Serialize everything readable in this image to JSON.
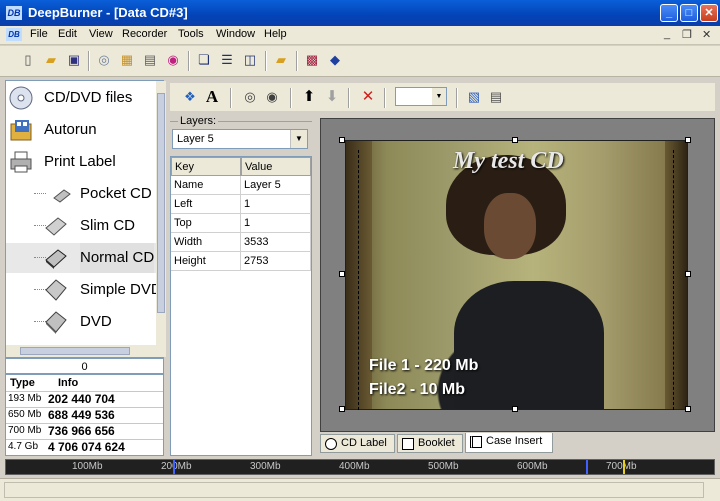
{
  "window": {
    "title": "DeepBurner - [Data CD#3]",
    "logo_text": "DB",
    "minimize_glyph": "_",
    "maximize_glyph": "□",
    "close_glyph": "✕"
  },
  "menu": {
    "items": [
      "File",
      "Edit",
      "View",
      "Recorder",
      "Tools",
      "Window",
      "Help"
    ],
    "mdi": {
      "minimize": "_",
      "restore": "❐",
      "close": "✕"
    }
  },
  "tree": {
    "items": [
      {
        "label": "CD/DVD files",
        "icon": "cd-disc-icon"
      },
      {
        "label": "Autorun",
        "icon": "autorun-icon"
      },
      {
        "label": "Print Label",
        "icon": "printer-icon"
      },
      {
        "label": "Pocket CD",
        "icon": "pocket-cd-icon"
      },
      {
        "label": "Slim CD",
        "icon": "slim-cd-icon"
      },
      {
        "label": "Normal CD",
        "icon": "normal-cd-icon"
      },
      {
        "label": "Simple DVD",
        "icon": "simple-dvd-icon"
      },
      {
        "label": "DVD",
        "icon": "dvd-icon"
      }
    ],
    "selected": "Normal CD"
  },
  "info": {
    "count": "0",
    "headers": {
      "type": "Type",
      "info": "Info"
    },
    "rows": [
      {
        "type": "193 Mb",
        "info": "202 440 704"
      },
      {
        "type": "650 Mb",
        "info": "688 449 536"
      },
      {
        "type": "700 Mb",
        "info": "736 966 656"
      },
      {
        "type": "4.7 Gb",
        "info": "4 706 074 624"
      }
    ]
  },
  "layers": {
    "label": "Layers:",
    "selected": "Layer 5",
    "grid_headers": {
      "key": "Key",
      "value": "Value"
    },
    "rows": [
      {
        "key": "Name",
        "value": "Layer 5"
      },
      {
        "key": "Left",
        "value": "1"
      },
      {
        "key": "Top",
        "value": "1"
      },
      {
        "key": "Width",
        "value": "3533"
      },
      {
        "key": "Height",
        "value": "2753"
      }
    ]
  },
  "canvas": {
    "title_text": "My test CD",
    "line1": "File 1 - 220 Mb",
    "line2": "File2 - 10 Mb"
  },
  "tabs": [
    {
      "label": "CD Label",
      "active": false
    },
    {
      "label": "Booklet",
      "active": false
    },
    {
      "label": "Case Insert",
      "active": true
    }
  ],
  "ruler": {
    "labels": [
      "100Mb",
      "200Mb",
      "300Mb",
      "400Mb",
      "500Mb",
      "600Mb",
      "700Mb"
    ],
    "marker_colors": {
      "blue": "#4060ff",
      "yellow": "#e8d020"
    }
  },
  "colors": {
    "titlebar": "#0343b8",
    "accent": "#0a5fd8"
  }
}
